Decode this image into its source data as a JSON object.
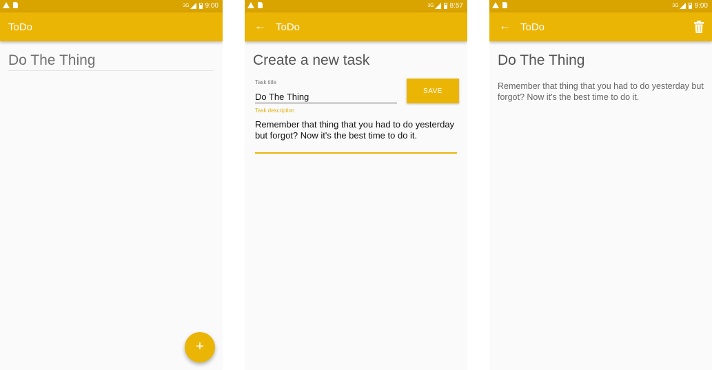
{
  "colors": {
    "status_bar": "#d9a300",
    "app_bar": "#ebb506",
    "accent": "#ebb506",
    "background": "#fafafa"
  },
  "screens": {
    "list": {
      "status": {
        "network": "3G",
        "time": "9:00"
      },
      "app_title": "ToDo",
      "items": [
        {
          "title": "Do The Thing"
        }
      ],
      "fab_icon": "+"
    },
    "create": {
      "status": {
        "network": "3G",
        "time": "8:57"
      },
      "back_icon": "←",
      "app_title": "ToDo",
      "heading": "Create a new task",
      "title_label": "Task title",
      "title_value": "Do The Thing",
      "save_label": "SAVE",
      "description_label": "Task description",
      "description_value": "Remember that thing that you had to do yesterday but forgot? Now it's the best time to do it."
    },
    "detail": {
      "status": {
        "network": "3G",
        "time": "9:00"
      },
      "back_icon": "←",
      "app_title": "ToDo",
      "title": "Do The Thing",
      "description": "Remember that thing that you had to do yesterday but forgot? Now it's the best time to do it.",
      "delete_icon": "trash-icon"
    }
  }
}
